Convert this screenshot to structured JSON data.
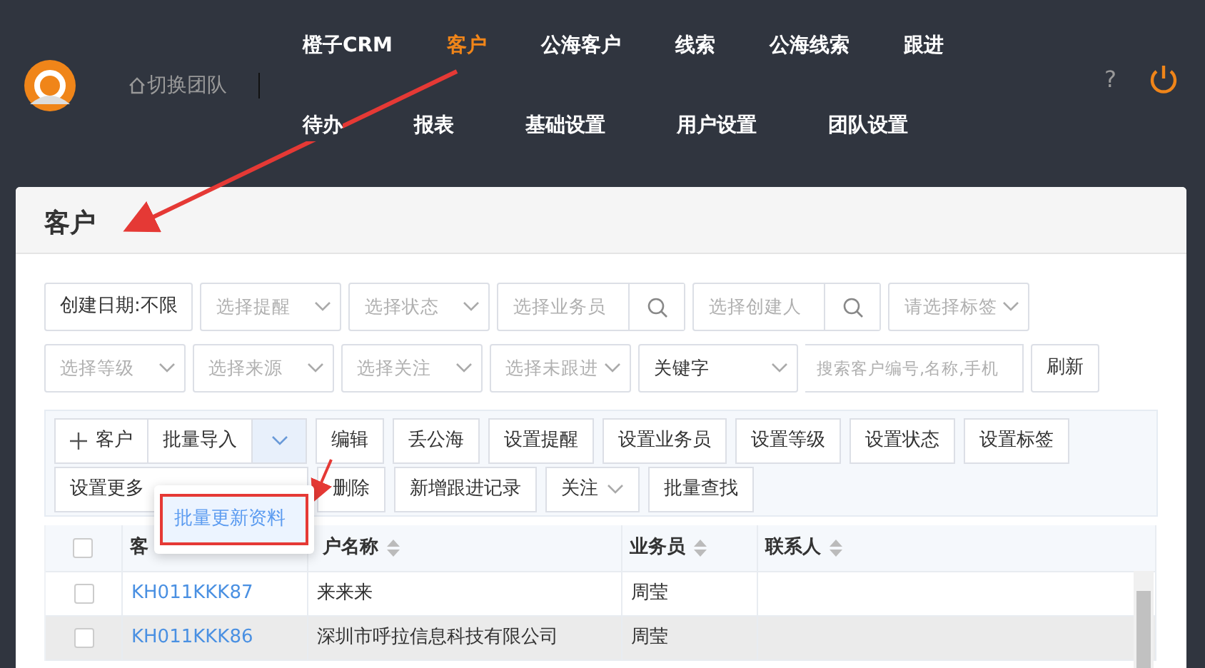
{
  "header": {
    "team_switch": "切换团队",
    "menu_rows": [
      [
        {
          "label": "橙子CRM",
          "selected": false
        },
        {
          "label": "客户",
          "selected": true
        },
        {
          "label": "公海客户",
          "selected": false
        },
        {
          "label": "线索",
          "selected": false
        },
        {
          "label": "公海线索",
          "selected": false
        },
        {
          "label": "跟进",
          "selected": false
        }
      ],
      [
        {
          "label": "待办",
          "selected": false
        },
        {
          "label": "报表",
          "selected": false
        },
        {
          "label": "基础设置",
          "selected": false
        },
        {
          "label": "用户设置",
          "selected": false
        },
        {
          "label": "团队设置",
          "selected": false
        }
      ]
    ],
    "help": "?"
  },
  "page_title": "客户",
  "filter_rows": [
    [
      {
        "kind": "button",
        "label": "创建日期:不限"
      },
      {
        "kind": "select",
        "placeholder": "选择提醒"
      },
      {
        "kind": "select",
        "placeholder": "选择状态"
      },
      {
        "kind": "search",
        "placeholder": "选择业务员"
      },
      {
        "kind": "search",
        "placeholder": "选择创建人"
      },
      {
        "kind": "select",
        "placeholder": "请选择标签"
      }
    ],
    [
      {
        "kind": "select",
        "placeholder": "选择等级"
      },
      {
        "kind": "select",
        "placeholder": "选择来源"
      },
      {
        "kind": "select",
        "placeholder": "选择关注"
      },
      {
        "kind": "select",
        "placeholder": "选择未跟进"
      },
      {
        "kind": "keyword",
        "value": "关键字",
        "placeholder": "搜索客户编号,名称,手机"
      },
      {
        "kind": "button",
        "label": "刷新"
      }
    ]
  ],
  "toolbar_rows": [
    [
      {
        "kind": "add",
        "label": "客户"
      },
      {
        "kind": "split",
        "label": "批量导入"
      },
      {
        "kind": "button",
        "label": "编辑"
      },
      {
        "kind": "button",
        "label": "丢公海"
      },
      {
        "kind": "button",
        "label": "设置提醒"
      },
      {
        "kind": "button",
        "label": "设置业务员"
      },
      {
        "kind": "button",
        "label": "设置等级"
      },
      {
        "kind": "button",
        "label": "设置状态"
      },
      {
        "kind": "button",
        "label": "设置标签"
      }
    ],
    [
      {
        "kind": "wide",
        "label": "设置更多"
      },
      {
        "kind": "button",
        "label": "删除"
      },
      {
        "kind": "button",
        "label": "新增跟进记录"
      },
      {
        "kind": "dropdown",
        "label": "关注"
      },
      {
        "kind": "button",
        "label": "批量查找"
      }
    ]
  ],
  "dropdown_menu": {
    "items": [
      {
        "label": "批量更新资料",
        "highlighted": true
      }
    ]
  },
  "table": {
    "all_checked": false,
    "columns": [
      {
        "label": "客",
        "sortable": false
      },
      {
        "label": "户名称",
        "sortable": true
      },
      {
        "label": "业务员",
        "sortable": true
      },
      {
        "label": "联系人",
        "sortable": true
      }
    ],
    "rows": [
      {
        "checked": false,
        "selected": false,
        "cells": [
          "KH011KKK87",
          "来来来",
          "周莹",
          ""
        ]
      },
      {
        "checked": false,
        "selected": true,
        "cells": [
          "KH011KKK86",
          "深圳市呼拉信息科技有限公司",
          "周莹",
          ""
        ]
      }
    ]
  }
}
